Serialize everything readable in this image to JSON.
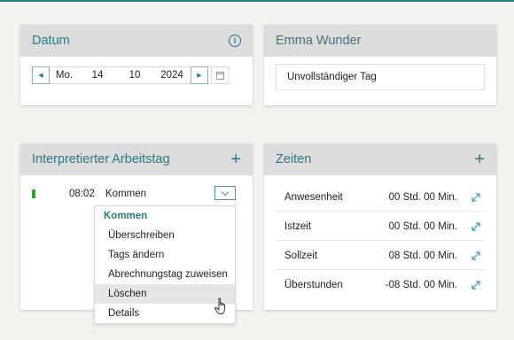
{
  "datum": {
    "title": "Datum",
    "weekday": "Mo.",
    "day": "14",
    "month": "10",
    "year": "2024"
  },
  "person": {
    "name": "Emma Wunder",
    "status": "Unvollständiger Tag"
  },
  "arbeitstag": {
    "title": "Interpretierter Arbeitstag",
    "entry": {
      "time": "08:02",
      "label": "Kommen",
      "status_color": "#2aa52a"
    },
    "menu": {
      "header": "Kommen",
      "items": [
        "Überschreiben",
        "Tags ändern",
        "Abrechnungstag zuweisen",
        "Löschen",
        "Details"
      ],
      "highlighted": "Löschen"
    }
  },
  "zeiten": {
    "title": "Zeiten",
    "rows": [
      {
        "label": "Anwesenheit",
        "value": "00 Std. 00 Min."
      },
      {
        "label": "Istzeit",
        "value": "00 Std. 00 Min."
      },
      {
        "label": "Sollzeit",
        "value": "08 Std. 00 Min."
      },
      {
        "label": "Überstunden",
        "value": "-08 Std. 00 Min."
      }
    ]
  },
  "icons": {
    "info": "info-icon",
    "add": "plus-icon",
    "expand": "expand-icon",
    "calendar": "calendar-icon"
  },
  "colors": {
    "accent": "#2a7a88",
    "header_bg": "#dcdcdc",
    "page_bg": "#f3f2ee",
    "status_green": "#2aa52a"
  }
}
